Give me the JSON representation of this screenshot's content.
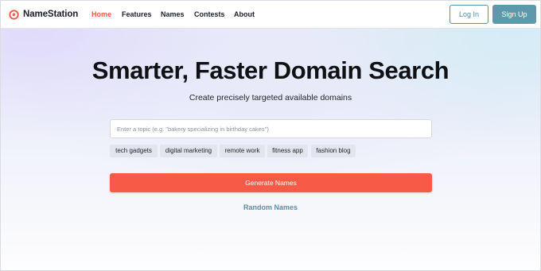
{
  "brand": {
    "name": "NameStation",
    "logo_icon": "at-sign-logo-icon",
    "accent_color": "#f0594a"
  },
  "nav": {
    "items": [
      {
        "label": "Home",
        "active": true
      },
      {
        "label": "Features",
        "active": false
      },
      {
        "label": "Names",
        "active": false
      },
      {
        "label": "Contests",
        "active": false
      },
      {
        "label": "About",
        "active": false
      }
    ],
    "login_label": "Log In",
    "signup_label": "Sign Up",
    "button_color": "#5e98ad"
  },
  "hero": {
    "title": "Smarter, Faster Domain Search",
    "subtitle": "Create precisely targeted available domains"
  },
  "search": {
    "value": "",
    "placeholder": "Enter a topic (e.g. \"bakery specializing in birthday cakes\")"
  },
  "suggestions": [
    "tech gadgets",
    "digital marketing",
    "remote work",
    "fitness app",
    "fashion blog"
  ],
  "actions": {
    "generate_label": "Generate Names",
    "generate_color": "#f75b47",
    "random_label": "Random Names"
  }
}
